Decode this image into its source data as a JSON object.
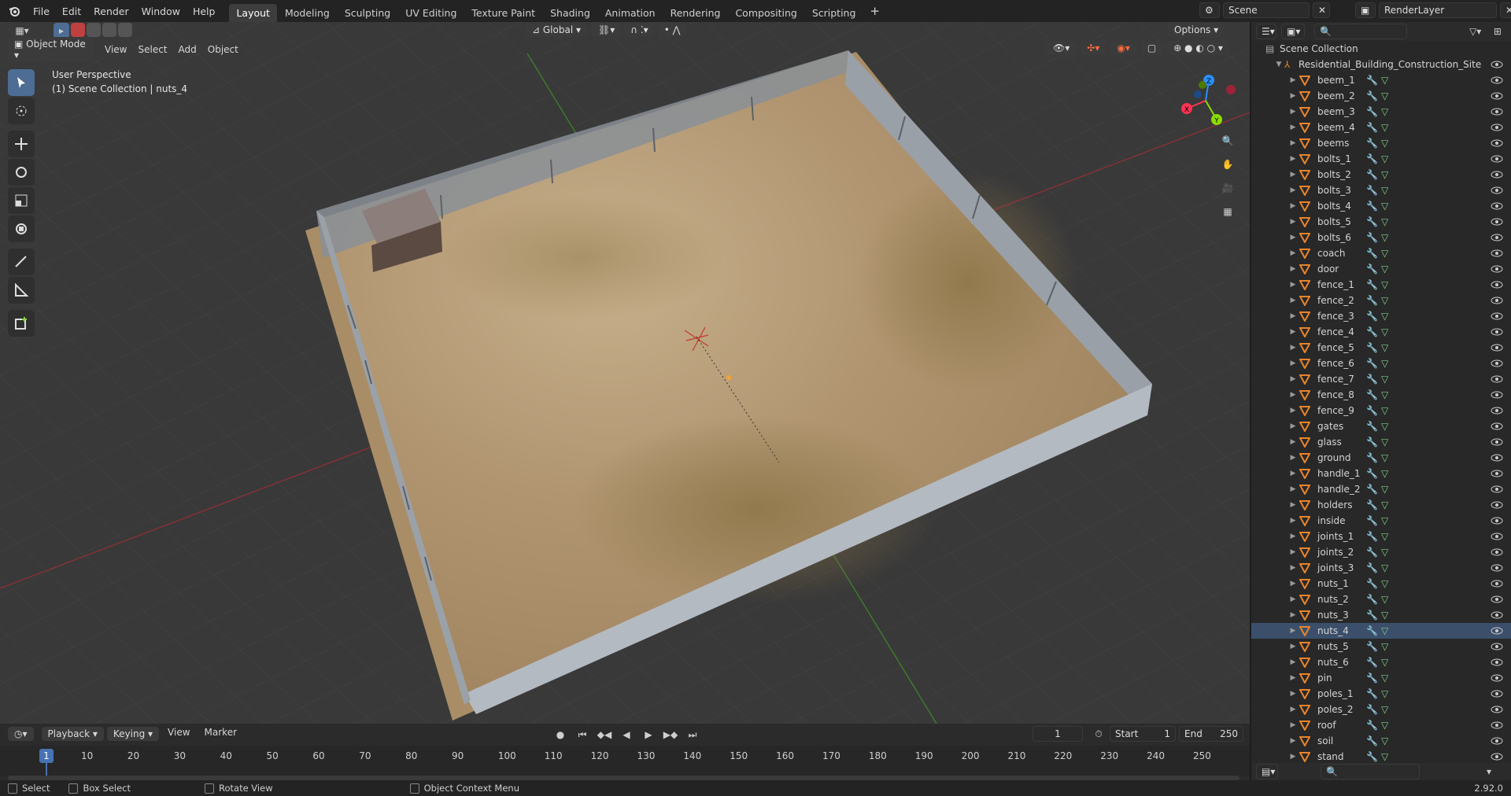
{
  "topbar": {
    "menus": [
      "File",
      "Edit",
      "Render",
      "Window",
      "Help"
    ],
    "workspaces": [
      "Layout",
      "Modeling",
      "Sculpting",
      "UV Editing",
      "Texture Paint",
      "Shading",
      "Animation",
      "Rendering",
      "Compositing",
      "Scripting"
    ],
    "active_workspace": "Layout",
    "add_tab": "+",
    "scene": "Scene",
    "render_layer": "RenderLayer"
  },
  "viewport": {
    "mode": "Object Mode",
    "menus": [
      "View",
      "Select",
      "Add",
      "Object"
    ],
    "transform_orientation": "Global",
    "options": "Options",
    "overlay_title": "User Perspective",
    "overlay_subtitle": "(1) Scene Collection | nuts_4",
    "gizmo": {
      "x": "X",
      "y": "Y",
      "z": "Z"
    }
  },
  "outliner": {
    "root": "Scene Collection",
    "collection": "Residential_Building_Construction_Site",
    "selected": "nuts_4",
    "items": [
      "beem_1",
      "beem_2",
      "beem_3",
      "beem_4",
      "beems",
      "bolts_1",
      "bolts_2",
      "bolts_3",
      "bolts_4",
      "bolts_5",
      "bolts_6",
      "coach",
      "door",
      "fence_1",
      "fence_2",
      "fence_3",
      "fence_4",
      "fence_5",
      "fence_6",
      "fence_7",
      "fence_8",
      "fence_9",
      "gates",
      "glass",
      "ground",
      "handle_1",
      "handle_2",
      "holders",
      "inside",
      "joints_1",
      "joints_2",
      "joints_3",
      "nuts_1",
      "nuts_2",
      "nuts_3",
      "nuts_4",
      "nuts_5",
      "nuts_6",
      "pin",
      "poles_1",
      "poles_2",
      "roof",
      "soil",
      "stand"
    ]
  },
  "timeline": {
    "menus": [
      "Playback",
      "Keying",
      "View",
      "Marker"
    ],
    "current_frame": "1",
    "start_label": "Start",
    "start": "1",
    "end_label": "End",
    "end": "250",
    "ruler": [
      "10",
      "20",
      "30",
      "40",
      "50",
      "60",
      "70",
      "80",
      "90",
      "100",
      "110",
      "120",
      "130",
      "140",
      "150",
      "160",
      "170",
      "180",
      "190",
      "200",
      "210",
      "220",
      "230",
      "240",
      "250"
    ],
    "playhead": "1"
  },
  "statusbar": {
    "select": "Select",
    "box_select": "Box Select",
    "rotate_view": "Rotate View",
    "context_menu": "Object Context Menu",
    "version": "2.92.0"
  },
  "colors": {
    "accent": "#4772b3",
    "selected_tool": "#4e6d95",
    "mesh_icon": "#e8842b",
    "axis_x": "#ff3352",
    "axis_y": "#8bdc00",
    "axis_z": "#2890ff"
  }
}
